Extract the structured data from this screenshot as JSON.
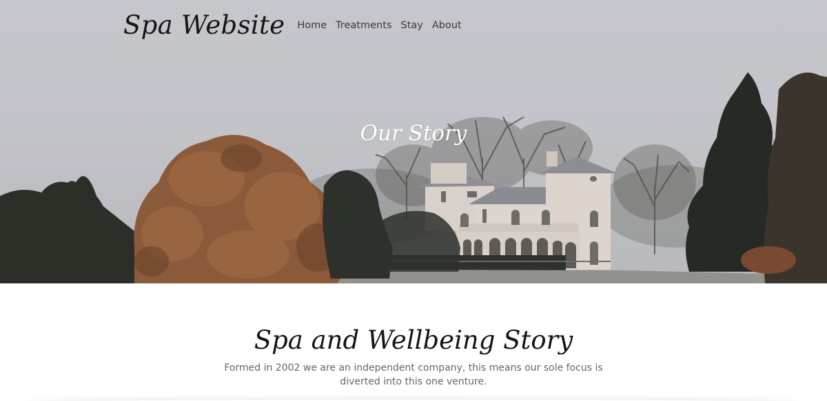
{
  "header": {
    "brand": "Spa Website",
    "nav": [
      {
        "label": "Home"
      },
      {
        "label": "Treatments"
      },
      {
        "label": "Stay"
      },
      {
        "label": "About"
      }
    ]
  },
  "hero": {
    "title": "Our Story"
  },
  "content": {
    "heading": "Spa and Wellbeing Story",
    "body": "Formed in 2002 we are an independent company, this means our sole focus is diverted into this one venture."
  }
}
